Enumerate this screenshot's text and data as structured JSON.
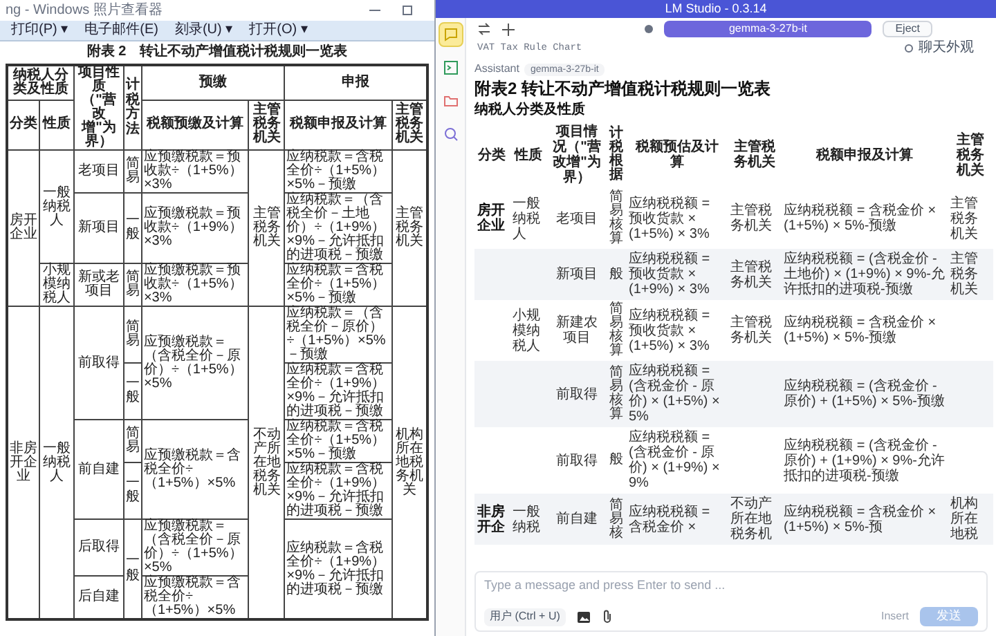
{
  "viewer": {
    "title": "ng - Windows 照片查看器",
    "menu": [
      "打印(P) ▾",
      "电子邮件(E)",
      "刻录(U) ▾",
      "打开(O) ▾"
    ],
    "document": {
      "title": "附表 2　转让不动产增值税计税规则一览表",
      "header_1": [
        {
          "text": "纳税人分类及性质",
          "colspan": 2
        },
        {
          "text": "项目性质（\"营改增\"为界）",
          "rowspan": 2
        },
        {
          "text": "计税方法",
          "rowspan": 2,
          "kind": "vertical"
        },
        {
          "text": "预缴",
          "colspan": 2
        },
        {
          "text": "申报",
          "colspan": 2
        }
      ],
      "header_2": [
        "分类",
        "性质",
        "税额预缴及计算",
        "主管税务机关",
        "税额申报及计算",
        "主管税务机关"
      ],
      "rows": [
        [
          {
            "text": "房开企业",
            "rowspan": 4
          },
          {
            "text": "一般纳税人",
            "rowspan": 3
          },
          {
            "text": "老项目",
            "rowspan": 2
          },
          {
            "text": "简易",
            "kind": "vertical"
          },
          {
            "text": "应预缴税款＝预收款÷（1+5%）×3%",
            "kind": "formula"
          },
          {
            "text": "主管税务机关",
            "rowspan": 4
          },
          {
            "text": "应纳税款＝含税全价÷（1+5%）×5%－预缴",
            "kind": "formula"
          },
          {
            "text": "主管税务机关",
            "rowspan": 4
          }
        ],
        [
          {
            "text": "一般",
            "rowspan": 2,
            "kind": "vertical"
          },
          {
            "text": "应预缴税款＝预收款÷（1+9%）×3%",
            "rowspan": 2,
            "kind": "formula"
          },
          {
            "text": "应纳税款＝（含税全价－土地价）÷（1+9%）×9%－允许抵扣的进项税－预缴",
            "rowspan": 2,
            "kind": "formula"
          }
        ],
        [
          "新项目"
        ],
        [
          "小规模纳税人",
          "新或老项目",
          {
            "text": "简易",
            "kind": "vertical"
          },
          {
            "text": "应预缴税款＝预收款÷（1+5%）×3%",
            "kind": "formula"
          },
          {
            "text": "应纳税款＝含税全价÷（1+5%）×5%－预缴",
            "kind": "formula"
          }
        ],
        [
          {
            "text": "非房开企业",
            "rowspan": 6
          },
          {
            "text": "一般纳税人",
            "rowspan": 6
          },
          {
            "text": "前取得",
            "rowspan": 2
          },
          {
            "text": "简易",
            "kind": "vertical"
          },
          {
            "text": "应预缴税款＝（含税全价－原价）÷（1+5%）×5%",
            "rowspan": 2,
            "kind": "formula"
          },
          {
            "text": "不动产所在地税务机关",
            "rowspan": 6
          },
          {
            "text": "应纳税款＝（含税全价－原价）÷（1+5%）×5%－预缴",
            "kind": "formula"
          },
          {
            "text": "机构所在地税务机关",
            "rowspan": 6
          }
        ],
        [
          {
            "text": "一般",
            "kind": "vertical"
          },
          {
            "text": "应纳税款＝含税全价÷（1+9%）×9%－允许抵扣的进项税－预缴",
            "kind": "formula"
          }
        ],
        [
          {
            "text": "前自建",
            "rowspan": 2
          },
          {
            "text": "简易",
            "kind": "vertical"
          },
          {
            "text": "应预缴税款＝含税全价÷（1+5%）×5%",
            "rowspan": 2,
            "kind": "formula"
          },
          {
            "text": "应纳税款＝含税全价÷（1+5%）×5%－预缴",
            "kind": "formula"
          }
        ],
        [
          {
            "text": "一般",
            "kind": "vertical"
          },
          {
            "text": "应纳税款＝含税全价÷（1+9%）×9%－允许抵扣的进项税－预缴",
            "kind": "formula"
          }
        ],
        [
          "后取得",
          {
            "text": "一般",
            "rowspan": 2,
            "kind": "vertical"
          },
          {
            "text": "应预缴税款＝（含税全价－原价）÷（1+5%）×5%",
            "kind": "formula"
          },
          {
            "text": "应纳税款＝含税全价÷（1+9%）×9%－允许抵扣的进项税－预缴",
            "rowspan": 2,
            "kind": "formula"
          }
        ],
        [
          "后自建",
          {
            "text": "应预缴税款＝含税全价÷（1+5%）×5%",
            "kind": "formula"
          }
        ]
      ]
    }
  },
  "app": {
    "title": "LM Studio - 0.3.14",
    "sidebar": [
      {
        "kind": "chat",
        "selected": true
      },
      {
        "kind": "terminal",
        "selected": false
      },
      {
        "kind": "folder",
        "selected": false
      },
      {
        "kind": "search",
        "selected": false
      }
    ],
    "model": "gemma-3-27b-it",
    "eject": "Eject",
    "chat_title": "VAT Tax Rule Chart",
    "appearance": "聊天外观",
    "message": {
      "role": "Assistant",
      "model": "gemma-3-27b-it",
      "heading": "附表2 转让不动产增值税计税规则一览表",
      "subheading": "纳税人分类及性质",
      "table": {
        "columns": [
          "分类",
          "性质",
          "项目情况（\"营改增\"为界）",
          "计税根据",
          "税额预估及计算",
          "主管税务机关",
          "税额申报及计算",
          "主管税务机关"
        ],
        "rows": [
          [
            "房开企业",
            "一般纳税人",
            "老项目",
            "简易核算",
            "应纳税税额 = 预收货款 × (1+5%) × 3%",
            "主管税务机关",
            "应纳税税额 = 含税金价 × (1+5%) × 5%-预缴",
            "主管税务机关"
          ],
          [
            "",
            "",
            "新项目",
            "般",
            "应纳税税额 = 预收货款 × (1+9%) × 3%",
            "主管税务机关",
            "应纳税税额 = (含税金价 - 土地价) × (1+9%) × 9%-允许抵扣的进项税-预缴",
            "主管税务机关"
          ],
          [
            "",
            "小规模纳税人",
            "新建农项目",
            "简易核算",
            "应纳税税额 = 预收货款 × (1+5%) × 3%",
            "主管税务机关",
            "应纳税税额 = 含税金价 × (1+5%) × 5%-预缴",
            ""
          ],
          [
            "",
            "",
            "前取得",
            "简易核算",
            "应纳税税额 = (含税金价 - 原价) × (1+5%) × 5%",
            "",
            "应纳税税额 = (含税金价 - 原价) + (1+5%) × 5%-预缴",
            ""
          ],
          [
            "",
            "",
            "前取得",
            "般",
            "应纳税税额 = (含税金价 - 原价) × (1+9%) × 9%",
            "",
            "应纳税税额 = (含税金价 - 原价) + (1+9%) × 9%-允许抵扣的进项税-预缴",
            ""
          ],
          [
            "非房开企",
            "一般纳税",
            "前自建",
            "简易核",
            "应纳税税额 = 含税金价 ×",
            "不动产所在地税务机",
            "应纳税税额 = 含税金价 × (1+5%) × 5%-预",
            "机构所在地税"
          ]
        ]
      }
    },
    "composer": {
      "placeholder": "Type a message and press Enter to send ...",
      "role_button": "用户 (Ctrl + U)",
      "insert": "Insert",
      "send": "发送"
    }
  }
}
